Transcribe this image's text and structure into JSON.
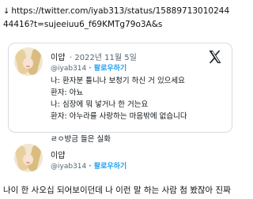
{
  "link": {
    "icon": "download-arrow-icon",
    "text": "https://twitter.com/iyab313/status/1588971301024444416?t=sujeeiuu6_f69KMTg79o3A&s"
  },
  "tweet1": {
    "name": "이얍",
    "date": "· 2022년 11월 5일",
    "handle": "@iyab314",
    "follow_label": "· 팔로우하기",
    "logo": "x-logo-icon",
    "lines": [
      "나: 환자분 틀니나 보청기 하신 거 있으세요",
      "환자: 아뇨",
      "나: 심장에 뭐 넣거나 한 거는요",
      "환자: 아누라를 사랑하는 마음밖에 없습니다",
      "",
      "ㄹㅇ방금 들은 실화"
    ]
  },
  "tweet2": {
    "name": "이얍",
    "handle": "@iyab314",
    "follow_label": "· 팔로우하기",
    "text": "나이 한 사오십 되어보이던데 나 이런 말 하는 사람 첨 봤잖아 진짜"
  },
  "colors": {
    "link_blue": "#1d9bf0",
    "border": "#d7dbe0",
    "muted": "#536471",
    "text": "#0f1419"
  }
}
